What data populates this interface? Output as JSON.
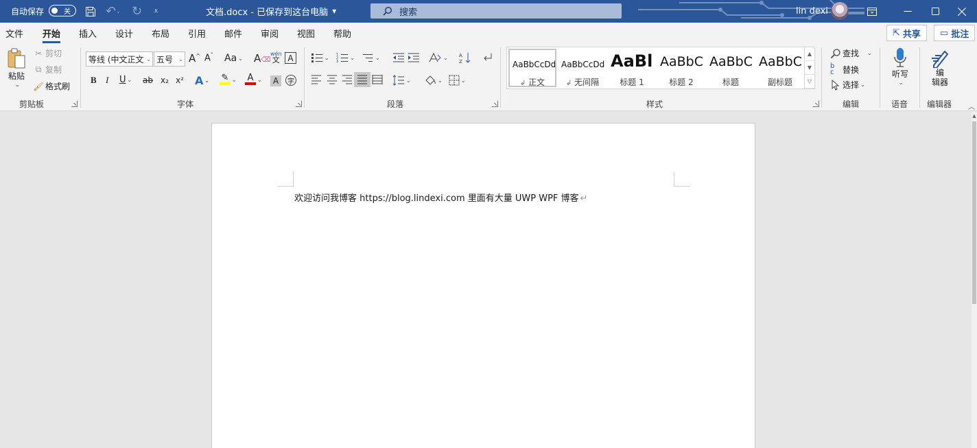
{
  "titlebar": {
    "autosave_label": "自动保存",
    "autosave_state": "关",
    "doc_title": "文档.docx - 已保存到这台电脑",
    "search_placeholder": "搜索",
    "user_name": "lin dexi",
    "bg_color": "#2b579a"
  },
  "tabs": [
    "文件",
    "开始",
    "插入",
    "设计",
    "布局",
    "引用",
    "邮件",
    "审阅",
    "视图",
    "帮助"
  ],
  "active_tab": "开始",
  "top_buttons": {
    "share": "共享",
    "comments": "批注"
  },
  "ribbon": {
    "clipboard": {
      "paste": "粘贴",
      "cut": "剪切",
      "copy": "复制",
      "format_painter": "格式刷",
      "group": "剪贴板"
    },
    "font": {
      "font_name": "等线 (中文正文",
      "font_size": "五号",
      "bold": "B",
      "italic": "I",
      "underline": "U",
      "strike": "ab",
      "subscript": "x₂",
      "superscript": "x²",
      "group": "字体",
      "aa": "Aa",
      "wen": "wén",
      "wen_char": "文",
      "a_box": "A"
    },
    "paragraph": {
      "group": "段落"
    },
    "styles": {
      "group": "样式",
      "items": [
        {
          "sample": "AaBbCcDd",
          "name": "正文",
          "mark": "↲"
        },
        {
          "sample": "AaBbCcDd",
          "name": "无间隔",
          "mark": "↲"
        },
        {
          "sample": "AaBl",
          "name": "标题 1",
          "mark": ""
        },
        {
          "sample": "AaBbC",
          "name": "标题 2",
          "mark": ""
        },
        {
          "sample": "AaBbC",
          "name": "标题",
          "mark": ""
        },
        {
          "sample": "AaBbC",
          "name": "副标题",
          "mark": ""
        }
      ]
    },
    "editing": {
      "find": "查找",
      "replace": "替换",
      "select": "选择",
      "group": "编辑"
    },
    "voice": {
      "dictate": "听写",
      "group": "语音"
    },
    "editor": {
      "label": "编\n辑器",
      "group": "编辑器",
      "line1": "编",
      "line2": "辑器"
    }
  },
  "document": {
    "text": "欢迎访问我博客  https://blog.lindexi.com  里面有大量  UWP WPF  博客",
    "para_mark": "↵"
  }
}
